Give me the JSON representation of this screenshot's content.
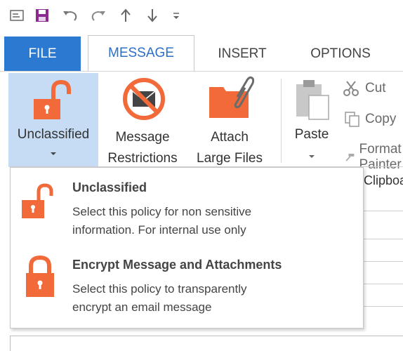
{
  "tabs": {
    "file": "FILE",
    "message": "MESSAGE",
    "insert": "INSERT",
    "options": "OPTIONS"
  },
  "ribbon": {
    "unclassified_label": "Unclassified",
    "restrictions_line1": "Message",
    "restrictions_line2": "Restrictions",
    "attach_line1": "Attach",
    "attach_line2": "Large Files",
    "paste_label": "Paste",
    "cut_label": "Cut",
    "copy_label": "Copy",
    "format_label": "Format Painter",
    "clipboard_group": "Clipboard"
  },
  "dropdown": {
    "options": [
      {
        "title": "Unclassified",
        "desc_line1": "Select this policy for non sensitive",
        "desc_line2": "information.  For internal use only",
        "icon": "unlocked-padlock-icon"
      },
      {
        "title": "Encrypt Message and Attachments",
        "desc_line1": "Select this policy to transparently",
        "desc_line2": "encrypt an email message",
        "icon": "locked-padlock-icon"
      }
    ]
  },
  "colors": {
    "accent_blue": "#2b79d0",
    "padlock_orange": "#f26a3a",
    "selected_bg": "#c5dcf4",
    "qat_purple": "#8b2a8f"
  }
}
